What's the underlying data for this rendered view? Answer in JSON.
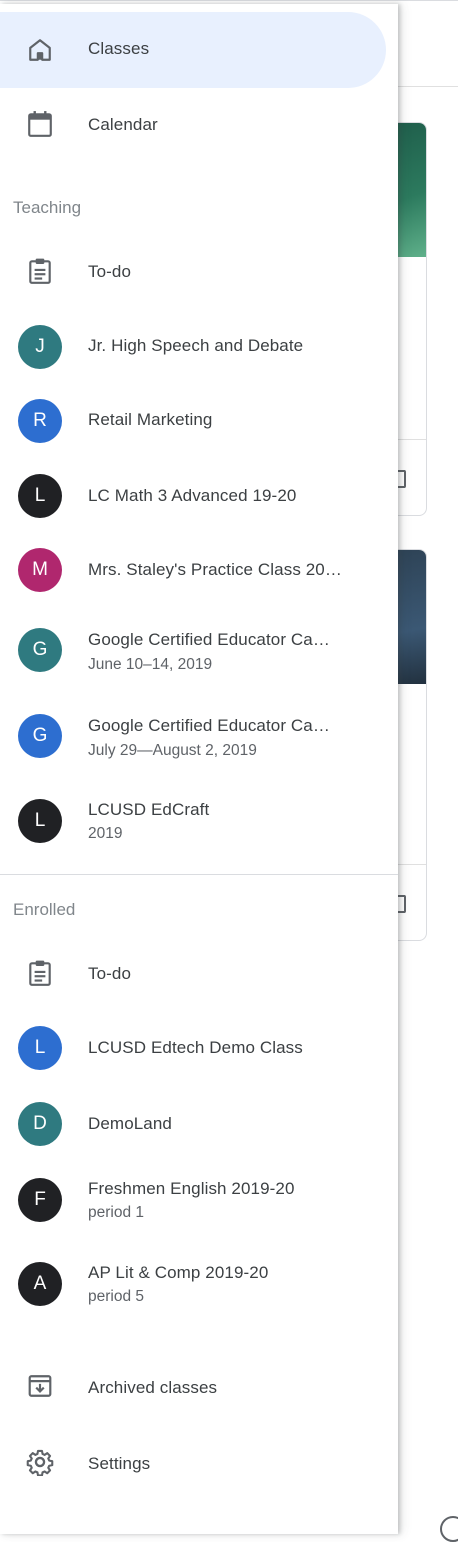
{
  "nav": {
    "classes_label": "Classes",
    "calendar_label": "Calendar",
    "archived_label": "Archived classes",
    "settings_label": "Settings"
  },
  "teaching": {
    "title": "Teaching",
    "todo_label": "To-do",
    "classes": [
      {
        "initial": "J",
        "name": "Jr. High Speech and Debate",
        "sub": "",
        "color": "#2f7a80"
      },
      {
        "initial": "R",
        "name": "Retail Marketing",
        "sub": "",
        "color": "#2d6ed0"
      },
      {
        "initial": "L",
        "name": "LC Math 3 Advanced 19-20",
        "sub": "",
        "color": "#202124"
      },
      {
        "initial": "M",
        "name": "Mrs. Staley's Practice Class 20…",
        "sub": "",
        "color": "#b0276e"
      },
      {
        "initial": "G",
        "name": "Google Certified Educator Ca…",
        "sub": "June 10–14, 2019",
        "color": "#2f7a80"
      },
      {
        "initial": "G",
        "name": "Google Certified Educator Ca…",
        "sub": "July 29—August 2, 2019",
        "color": "#2d6ed0"
      },
      {
        "initial": "L",
        "name": "LCUSD EdCraft",
        "sub": "2019",
        "color": "#202124"
      }
    ]
  },
  "enrolled": {
    "title": "Enrolled",
    "todo_label": "To-do",
    "classes": [
      {
        "initial": "L",
        "name": "LCUSD Edtech Demo Class",
        "sub": "",
        "color": "#2d6ed0"
      },
      {
        "initial": "D",
        "name": "DemoLand",
        "sub": "",
        "color": "#2f7a80"
      },
      {
        "initial": "F",
        "name": "Freshmen English 2019-20",
        "sub": "period 1",
        "color": "#202124"
      },
      {
        "initial": "A",
        "name": "AP Lit & Comp 2019-20",
        "sub": "period 5",
        "color": "#202124"
      }
    ]
  },
  "colors": {
    "active_bg": "#e8f0fe",
    "icon": "#5f6368",
    "text": "#3c4043",
    "section_title": "#80868b"
  },
  "icons": {
    "classes": "home-icon",
    "calendar": "calendar-icon",
    "todo": "clipboard-icon",
    "archived": "archive-icon",
    "settings": "gear-icon"
  }
}
